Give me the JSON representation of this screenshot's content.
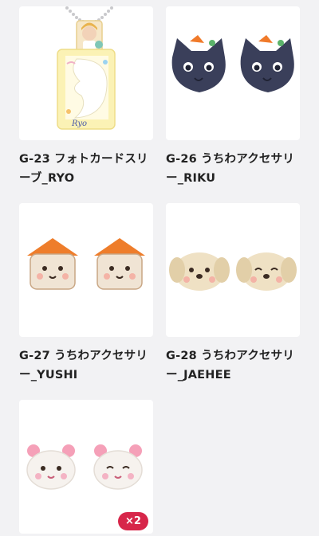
{
  "products": [
    {
      "code": "G-23",
      "title": "G-23 フォトカードスリーブ_RYO",
      "image": "photocard-sleeve"
    },
    {
      "code": "G-26",
      "title": "G-26 うちわアクセサリー_RIKU",
      "image": "black-cat-accessory"
    },
    {
      "code": "G-27",
      "title": "G-27 うちわアクセサリー_YUSHI",
      "image": "orange-hat-cat-accessory"
    },
    {
      "code": "G-28",
      "title": "G-28 うちわアクセサリー_JAEHEE",
      "image": "dog-accessory"
    },
    {
      "code": "",
      "title": "",
      "image": "bear-accessory",
      "quantity_badge": "×2"
    }
  ],
  "sleeve_print": "Ryo",
  "colors": {
    "background": "#f2f2f4",
    "card": "#ffffff",
    "title": "#222222",
    "badge": "#d7264a"
  }
}
